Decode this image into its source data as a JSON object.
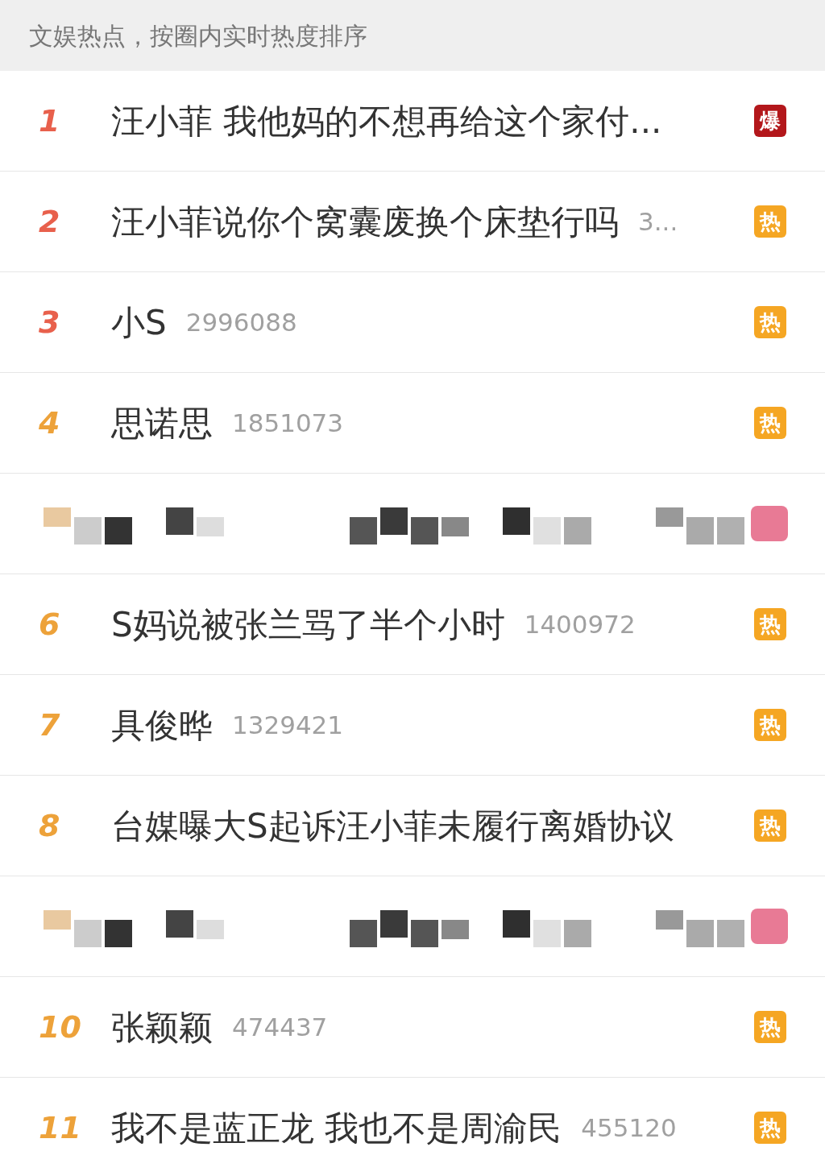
{
  "header": {
    "text": "文娱热点，按圈内实时热度排序"
  },
  "items": [
    {
      "kind": "topic",
      "rank": "1",
      "color": "#e8604c",
      "title": "汪小菲 我他妈的不想再给这个家付...",
      "badge": {
        "kind": "boom",
        "label": "爆"
      }
    },
    {
      "kind": "topic",
      "rank": "2",
      "color": "#e8604c",
      "title": "汪小菲说你个窝囊废换个床垫行吗",
      "count": "3...",
      "badge": {
        "kind": "hot",
        "label": "热"
      }
    },
    {
      "kind": "topic",
      "rank": "3",
      "color": "#e8604c",
      "title": "小S",
      "count": "2996088",
      "badge": {
        "kind": "hot",
        "label": "热"
      }
    },
    {
      "kind": "topic",
      "rank": "4",
      "color": "#eda23a",
      "title": "思诺思",
      "count": "1851073",
      "badge": {
        "kind": "hot",
        "label": "热"
      }
    },
    {
      "kind": "redacted"
    },
    {
      "kind": "topic",
      "rank": "6",
      "color": "#eda23a",
      "title": "S妈说被张兰骂了半个小时",
      "count": "1400972",
      "badge": {
        "kind": "hot",
        "label": "热"
      }
    },
    {
      "kind": "topic",
      "rank": "7",
      "color": "#eda23a",
      "title": "具俊晔",
      "count": "1329421",
      "badge": {
        "kind": "hot",
        "label": "热"
      }
    },
    {
      "kind": "topic",
      "rank": "8",
      "color": "#eda23a",
      "title": "台媒曝大S起诉汪小菲未履行离婚协议",
      "badge": {
        "kind": "hot",
        "label": "热"
      }
    },
    {
      "kind": "redacted"
    },
    {
      "kind": "topic",
      "rank": "10",
      "color": "#eda23a",
      "title": "张颖颖",
      "count": "474437",
      "badge": {
        "kind": "hot",
        "label": "热"
      }
    },
    {
      "kind": "topic",
      "rank": "11",
      "color": "#eda23a",
      "title": "我不是蓝正龙 我也不是周渝民",
      "count": "455120",
      "badge": {
        "kind": "hot",
        "label": "热"
      }
    }
  ]
}
